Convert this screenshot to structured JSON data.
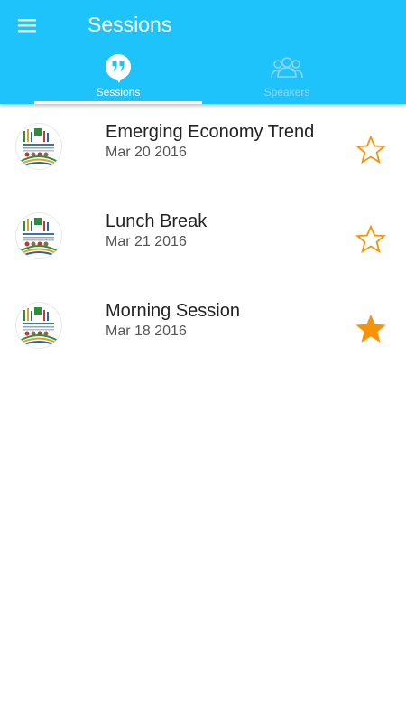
{
  "appbar": {
    "title": "Sessions",
    "menu_icon": "hamburger-menu-icon",
    "background_color": "#1ec3fb"
  },
  "tabs": [
    {
      "label": "Sessions",
      "icon": "quote-bubble-icon",
      "selected": true
    },
    {
      "label": "Speakers",
      "icon": "people-group-icon",
      "selected": false
    }
  ],
  "sessions": [
    {
      "title": "Emerging Economy Trend",
      "date": "Mar 20 2016",
      "starred": false,
      "avatar": "event-logo-avatar"
    },
    {
      "title": "Lunch Break",
      "date": "Mar 21 2016",
      "starred": false,
      "avatar": "event-logo-avatar"
    },
    {
      "title": "Morning Session",
      "date": "Mar 18 2016",
      "starred": true,
      "avatar": "event-logo-avatar"
    }
  ],
  "colors": {
    "star": "#f7930a",
    "tab_active": "#ffffff",
    "tab_inactive": "#8fd6f4"
  }
}
